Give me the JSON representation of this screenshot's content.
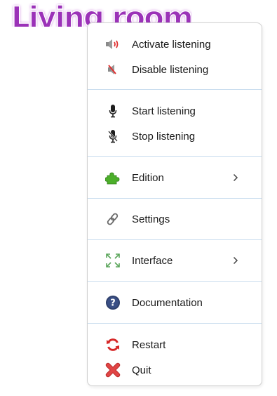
{
  "room": {
    "title": "Living room"
  },
  "menu": {
    "groups": [
      {
        "items": [
          {
            "label": "Activate listening",
            "icon": "speaker-on-icon"
          },
          {
            "label": "Disable listening",
            "icon": "speaker-off-icon"
          }
        ]
      },
      {
        "items": [
          {
            "label": "Start listening",
            "icon": "microphone-icon"
          },
          {
            "label": "Stop listening",
            "icon": "microphone-off-icon"
          }
        ]
      },
      {
        "items": [
          {
            "label": "Edition",
            "icon": "puzzle-icon",
            "submenu": true
          }
        ]
      },
      {
        "items": [
          {
            "label": "Settings",
            "icon": "link-icon"
          }
        ]
      },
      {
        "items": [
          {
            "label": "Interface",
            "icon": "expand-arrows-icon",
            "submenu": true
          }
        ]
      },
      {
        "items": [
          {
            "label": "Documentation",
            "icon": "help-icon"
          }
        ]
      },
      {
        "items": [
          {
            "label": "Restart",
            "icon": "refresh-icon"
          },
          {
            "label": "Quit",
            "icon": "close-icon"
          }
        ]
      }
    ]
  },
  "colors": {
    "title": "#9b32b8",
    "separator": "#c9ddee",
    "puzzle": "#4caf2a",
    "restart": "#d62828",
    "quit": "#d83a3a",
    "help": "#2e3f6b"
  }
}
